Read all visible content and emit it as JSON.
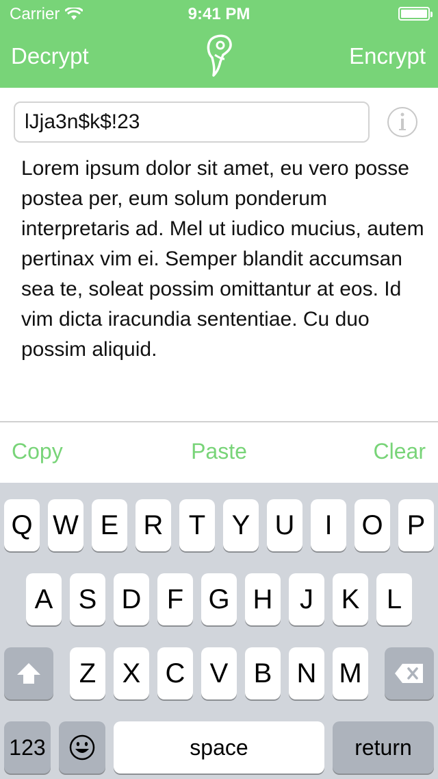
{
  "status_bar": {
    "carrier": "Carrier",
    "time": "9:41 PM"
  },
  "nav": {
    "left_label": "Decrypt",
    "right_label": "Encrypt",
    "logo_icon": "keyhole-logo-icon"
  },
  "key_field": {
    "value": "lJja3n$k$!23",
    "info_icon": "info-icon"
  },
  "body_text": "Lorem ipsum dolor sit amet, eu vero posse postea per, eum solum ponderum interpretaris ad. Mel ut iudico mucius, autem pertinax vim ei. Semper blandit accumsan sea te, soleat possim omittantur at eos. Id vim dicta iracundia sententiae. Cu duo possim aliquid.",
  "actions": {
    "copy": "Copy",
    "paste": "Paste",
    "clear": "Clear"
  },
  "keyboard": {
    "row1": [
      "Q",
      "W",
      "E",
      "R",
      "T",
      "Y",
      "U",
      "I",
      "O",
      "P"
    ],
    "row2": [
      "A",
      "S",
      "D",
      "F",
      "G",
      "H",
      "J",
      "K",
      "L"
    ],
    "row3": [
      "Z",
      "X",
      "C",
      "V",
      "B",
      "N",
      "M"
    ],
    "numbers": "123",
    "space": "space",
    "return": "return",
    "shift_icon": "shift-icon",
    "delete_icon": "delete-icon",
    "emoji_icon": "emoji-icon"
  },
  "colors": {
    "accent": "#78d478",
    "keyboard_bg": "#d1d5db",
    "dark_key": "#adb3bc"
  }
}
